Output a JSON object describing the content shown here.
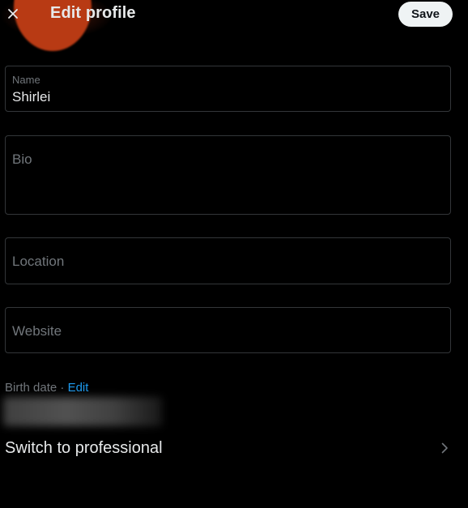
{
  "header": {
    "title": "Edit profile",
    "close_icon": "close-icon",
    "save_label": "Save"
  },
  "fields": {
    "name": {
      "label": "Name",
      "value": "Shirlei"
    },
    "bio": {
      "placeholder": "Bio",
      "value": ""
    },
    "location": {
      "placeholder": "Location",
      "value": ""
    },
    "website": {
      "placeholder": "Website",
      "value": ""
    }
  },
  "birth_date": {
    "label": "Birth date",
    "separator": " · ",
    "edit_label": "Edit"
  },
  "professional": {
    "label": "Switch to professional",
    "icon": "chevron-right-icon"
  },
  "colors": {
    "background": "#000000",
    "text": "#e7e9ea",
    "muted": "#71767b",
    "border": "#333639",
    "accent": "#1d9bf0",
    "save_bg": "#eff3f4",
    "avatar": "#b83a14"
  }
}
